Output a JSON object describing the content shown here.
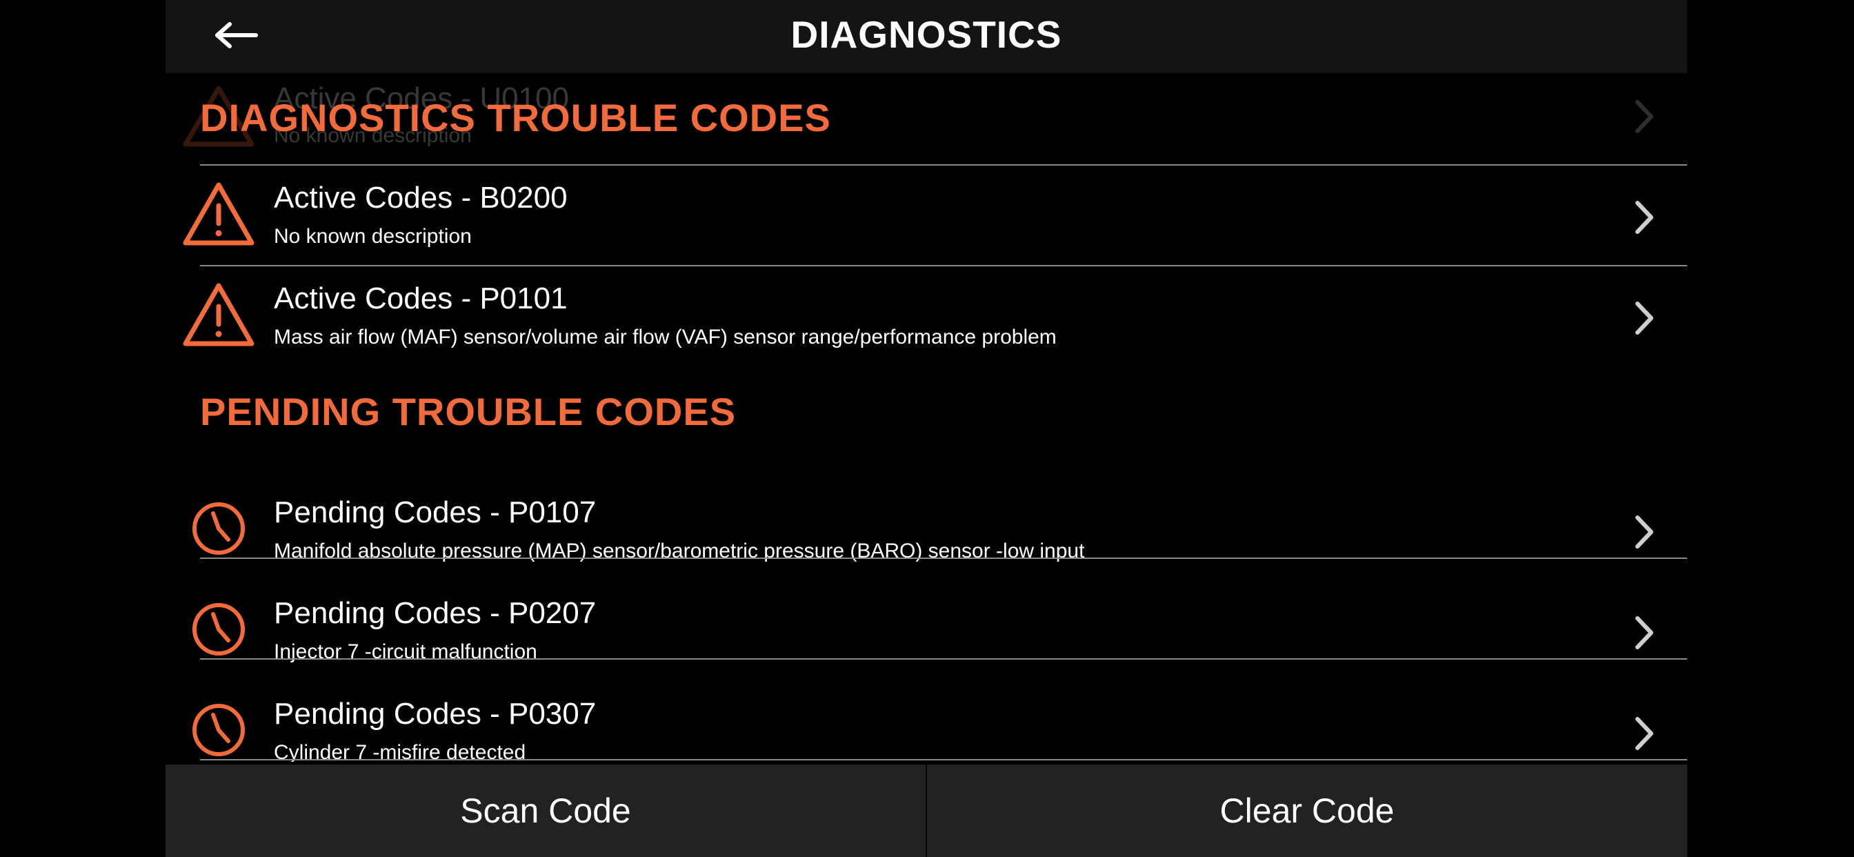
{
  "header": {
    "title": "DIAGNOSTICS",
    "back_icon": "arrow-left-icon"
  },
  "colors": {
    "accent": "#f36b3a",
    "background": "#000000",
    "navbar": "#141414",
    "bottom_bar": "#222222",
    "divider": "#8a8a8a"
  },
  "faded_row": {
    "title": "Active Codes - U0100",
    "description": "No known description"
  },
  "sections": {
    "diagnostics": {
      "title": "DIAGNOSTICS TROUBLE CODES",
      "icon": "warning-triangle-icon",
      "items": [
        {
          "title": "Active Codes - B0200",
          "description": "No known description"
        },
        {
          "title": "Active Codes - P0101",
          "description": "Mass air flow (MAF) sensor/volume air flow (VAF) sensor range/performance problem"
        }
      ]
    },
    "pending": {
      "title": "PENDING TROUBLE CODES",
      "icon": "clock-icon",
      "items": [
        {
          "title": "Pending Codes - P0107",
          "description": "Manifold absolute pressure (MAP) sensor/barometric pressure (BARO) sensor -low input"
        },
        {
          "title": "Pending Codes - P0207",
          "description": "Injector 7 -circuit malfunction"
        },
        {
          "title": "Pending Codes - P0307",
          "description": "Cylinder 7 -misfire detected"
        }
      ]
    }
  },
  "bottom": {
    "scan_label": "Scan Code",
    "clear_label": "Clear Code"
  }
}
